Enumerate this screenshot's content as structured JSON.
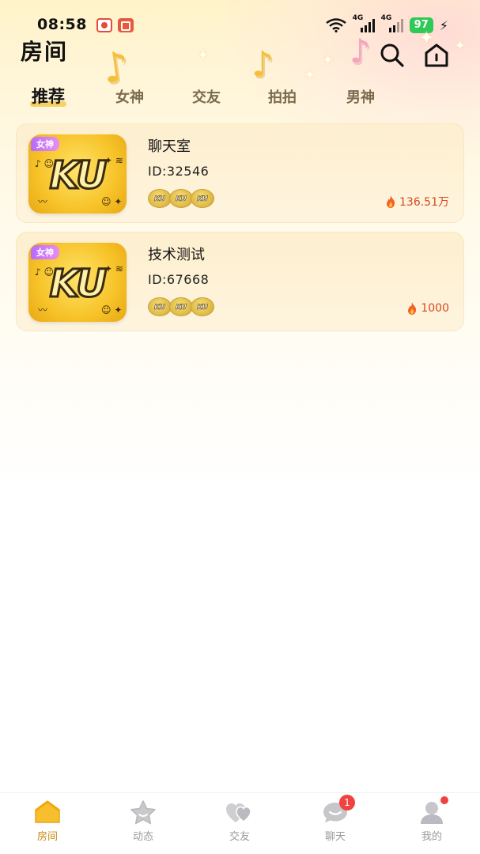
{
  "status_bar": {
    "time": "08:58",
    "signal_1_label": "4G",
    "signal_2_label": "4G",
    "battery": "97",
    "charging_icon": "bolt-icon"
  },
  "header": {
    "title": "房间",
    "search_icon": "search-icon",
    "home_icon": "home-icon"
  },
  "tabs": [
    {
      "label": "推荐",
      "active": true
    },
    {
      "label": "女神",
      "active": false
    },
    {
      "label": "交友",
      "active": false
    },
    {
      "label": "拍拍",
      "active": false
    },
    {
      "label": "男神",
      "active": false
    }
  ],
  "rooms": [
    {
      "tag": "女神",
      "cover_text": "KU",
      "name": "聊天室",
      "id": "ID:32546",
      "badges": [
        "KU",
        "KU",
        "KU"
      ],
      "heat": "136.51万"
    },
    {
      "tag": "女神",
      "cover_text": "KU",
      "name": "技术测试",
      "id": "ID:67668",
      "badges": [
        "KU",
        "KU",
        "KU"
      ],
      "heat": "1000"
    }
  ],
  "bottom_nav": [
    {
      "label": "房间",
      "icon": "home-icon",
      "active": true
    },
    {
      "label": "动态",
      "icon": "star-icon",
      "active": false
    },
    {
      "label": "交友",
      "icon": "hearts-icon",
      "active": false
    },
    {
      "label": "聊天",
      "icon": "chat-bubble-icon",
      "active": false,
      "badge": "1"
    },
    {
      "label": "我的",
      "icon": "user-icon",
      "active": false
    }
  ],
  "colors": {
    "accent": "#c98a12",
    "tab_highlight": "#f6c43c",
    "heat": "#d8481e",
    "badge_red": "#f0433f",
    "battery_green": "#2fc955"
  }
}
